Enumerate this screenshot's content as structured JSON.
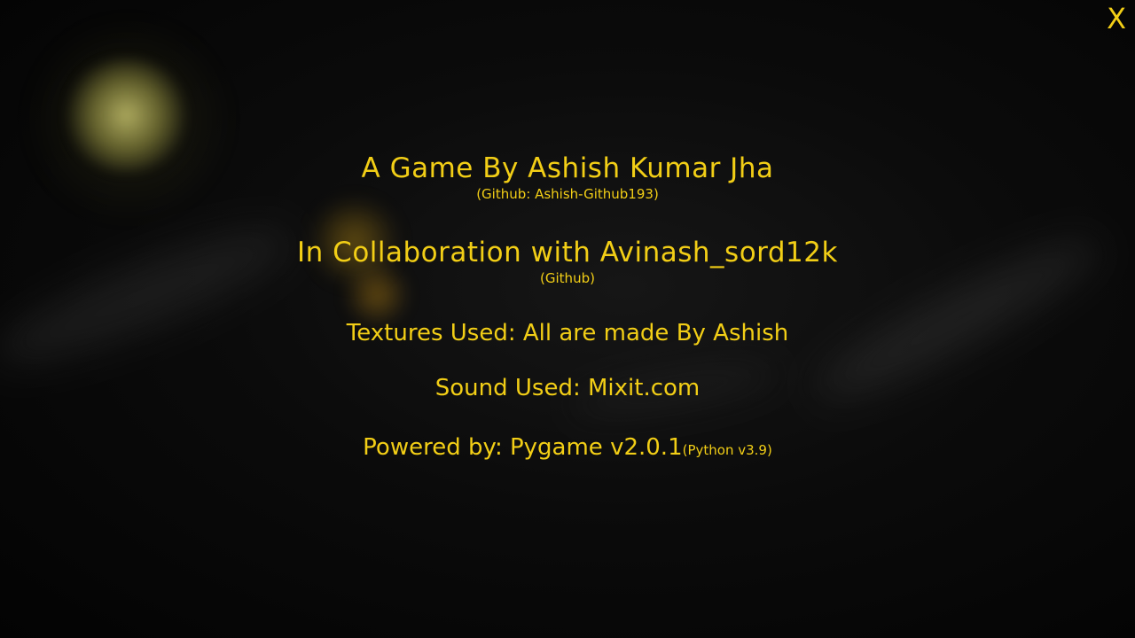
{
  "close_label": "X",
  "credits": {
    "author": "A Game By Ashish Kumar Jha",
    "author_github": "(Github: Ashish-Github193)",
    "collab": "In Collaboration with Avinash_sord12k",
    "collab_github": "(Github)",
    "textures": "Textures Used: All are made By Ashish",
    "sound": "Sound Used: Mixit.com",
    "powered": "Powered by: Pygame v2.0.1",
    "python": "(Python v3.9)"
  },
  "colors": {
    "text": "#f2ce16",
    "background": "#050505"
  }
}
